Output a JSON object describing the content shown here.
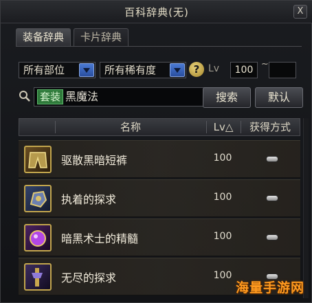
{
  "window": {
    "title": "百科辞典(无)",
    "close_label": "X"
  },
  "tabs": [
    {
      "label": "装备辞典",
      "active": true
    },
    {
      "label": "卡片辞典",
      "active": false
    }
  ],
  "filters": {
    "part_select": "所有部位",
    "rarity_select": "所有稀有度",
    "help_label": "?",
    "level_label": "Lv",
    "level_min": "100",
    "level_sep": "~",
    "level_max": ""
  },
  "search": {
    "tag": "套装",
    "query": "黑魔法",
    "search_button": "搜索",
    "default_button": "默认"
  },
  "table": {
    "headers": {
      "name": "名称",
      "level": "Lv△",
      "obtain": "获得方式"
    },
    "rows": [
      {
        "name": "驱散黑暗短裤",
        "level": "100",
        "icon": "shorts-icon"
      },
      {
        "name": "执着的探求",
        "level": "100",
        "icon": "gauntlet-icon"
      },
      {
        "name": "暗黑术士的精髓",
        "level": "100",
        "icon": "purple-orb-icon"
      },
      {
        "name": "无尽的探求",
        "level": "100",
        "icon": "staff-icon"
      }
    ]
  },
  "colors": {
    "tag_green": "#2f7a3b",
    "dropdown_blue": "#2a4fa0",
    "item_frame_gold": "#c3a64d",
    "watermark_orange": "#ff9a1f"
  },
  "watermark": "海量手游网"
}
